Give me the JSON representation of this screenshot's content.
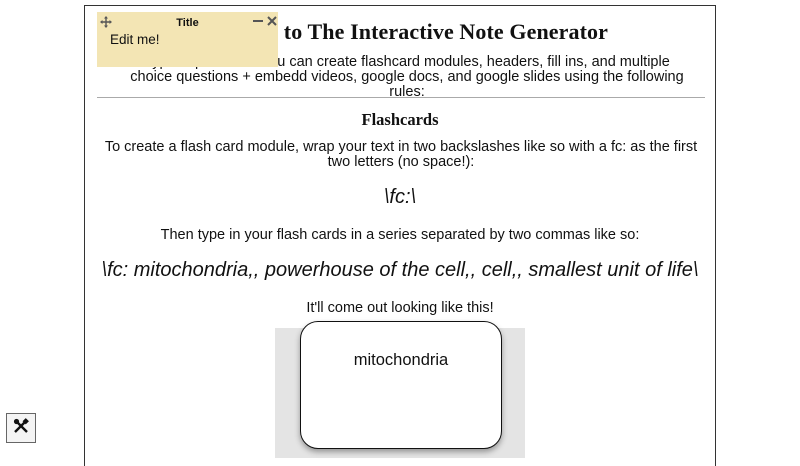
{
  "page": {
    "title": "Welcome to The Interactive Note Generator",
    "intro": "Type in plain text! You can create flashcard modules, headers, fill ins, and multiple choice questions + embedd videos, google docs, and google slides using the following rules:"
  },
  "flashcards": {
    "heading": "Flashcards",
    "instruction": "To create a flash card module, wrap your text in two backslashes like so with a fc: as the first two letters (no space!):",
    "syntax": "\\fc:\\",
    "instruction2": "Then type in your flash cards in a series separated by two commas like so:",
    "example": "\\fc: mitochondria,, powerhouse of the cell,, cell,, smallest unit of life\\",
    "result_label": "It'll come out looking like this!",
    "card_text": "mitochondria"
  },
  "sticky_note": {
    "title": "Title",
    "body": "Edit me!",
    "move_icon": "move-icon",
    "minimize_icon": "minimize-icon",
    "close_icon": "close-icon"
  },
  "toolbar": {
    "tools_icon": "tools-icon"
  }
}
